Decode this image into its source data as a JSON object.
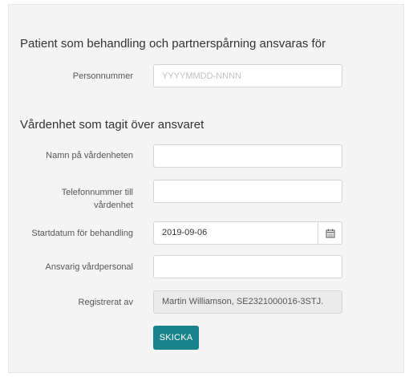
{
  "patient_section": {
    "heading": "Patient som behandling och partnerspårning ansvaras för",
    "personnummer": {
      "label": "Personnummer",
      "value": "",
      "placeholder": "YYYYMMDD-NNNN"
    }
  },
  "care_unit_section": {
    "heading": "Vårdenhet som tagit över ansvaret",
    "unit_name": {
      "label": "Namn på vårdenheten",
      "value": ""
    },
    "phone": {
      "label": "Telefonnummer till vårdenhet",
      "value": ""
    },
    "start_date": {
      "label": "Startdatum för behandling",
      "value": "2019-09-06",
      "icon": "calendar-icon"
    },
    "responsible_staff": {
      "label": "Ansvarig vårdpersonal",
      "value": ""
    },
    "registered_by": {
      "label": "Registrerat av",
      "value": "Martin Williamson, SE2321000016-3STJ."
    }
  },
  "submit_label": "SKICKA",
  "colors": {
    "accent": "#18838b",
    "panel_background": "#f4f4f4",
    "readonly_background": "#eaeaea"
  }
}
